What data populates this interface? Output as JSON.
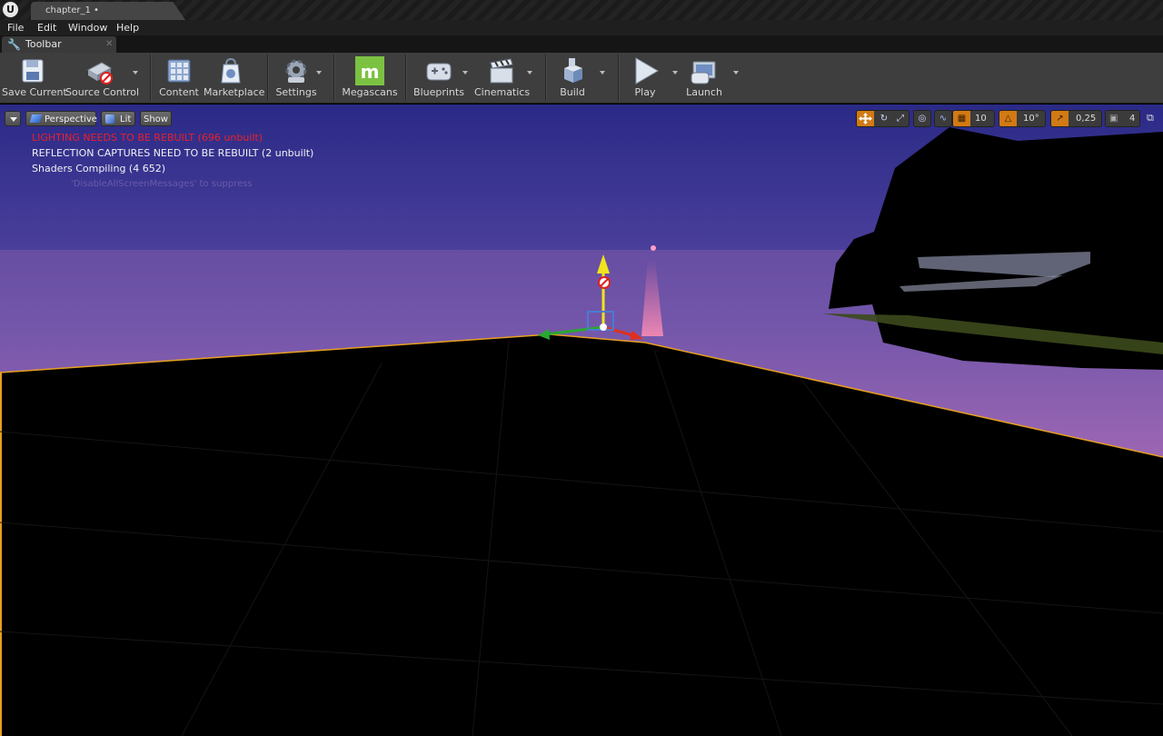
{
  "window": {
    "tab_title": "chapter_1 •"
  },
  "menu": [
    "File",
    "Edit",
    "Window",
    "Help"
  ],
  "toolbar_panel": {
    "tab_label": "Toolbar"
  },
  "toolbar": {
    "save_current": "Save Current",
    "source_control": "Source Control",
    "content": "Content",
    "marketplace": "Marketplace",
    "settings": "Settings",
    "megascans": "Megascans",
    "blueprints": "Blueprints",
    "cinematics": "Cinematics",
    "build": "Build",
    "play": "Play",
    "launch": "Launch"
  },
  "viewport": {
    "perspective": "Perspective",
    "lit": "Lit",
    "show": "Show",
    "grid_snap": "10",
    "rotation_snap": "10°",
    "scale_snap": "0,25",
    "camera_speed": "4"
  },
  "messages": {
    "lighting": "LIGHTING NEEDS TO BE REBUILT (696 unbuilt)",
    "reflection": "REFLECTION CAPTURES NEED TO BE REBUILT (2 unbuilt)",
    "shaders": "Shaders Compiling (4 652)",
    "suppress": "'DisableAllScreenMessages' to suppress"
  },
  "colors": {
    "accent": "#d27a14",
    "warning": "#e8202a",
    "sky_top": "#2a2a8a",
    "sky_bottom": "#b06cb4"
  }
}
